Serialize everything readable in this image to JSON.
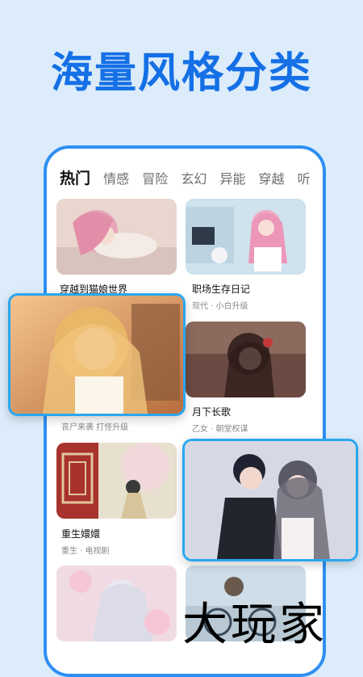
{
  "headline": "海量风格分类",
  "tabs": [
    {
      "label": "热门",
      "active": true
    },
    {
      "label": "情感",
      "active": false
    },
    {
      "label": "冒险",
      "active": false
    },
    {
      "label": "玄幻",
      "active": false
    },
    {
      "label": "异能",
      "active": false
    },
    {
      "label": "穿越",
      "active": false
    },
    {
      "label": "听",
      "active": false
    }
  ],
  "cards": [
    {
      "title": "穿越到猫娘世界",
      "tags": ""
    },
    {
      "title": "职场生存日记",
      "tags": "现代 · 小白升级"
    },
    {
      "title": "",
      "tags": "丧尸来袭  打怪升级"
    },
    {
      "title": "月下长歌",
      "tags": "乙女 · 朝堂权谋"
    },
    {
      "title": "重生嬛嬛",
      "tags": "重生 · 电视剧"
    }
  ],
  "watermark": "大玩家",
  "colors": {
    "accent": "#1570e6",
    "frame": "#2f8ff2",
    "tab_underline": "#f5b942"
  }
}
